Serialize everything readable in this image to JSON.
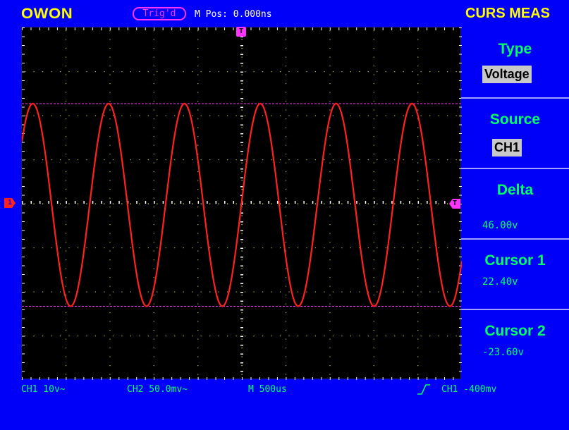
{
  "header": {
    "brand": "OWON",
    "trigger_status": "Trig'd",
    "m_pos": "M Pos: 0.000ns",
    "menu_title": "CURS MEAS"
  },
  "markers": {
    "trigger_pos": "T",
    "ch1_ground": "1",
    "trigger_level": "T"
  },
  "menu": {
    "type_label": "Type",
    "type_value": "Voltage",
    "source_label": "Source",
    "source_value": "CH1",
    "delta_label": "Delta",
    "delta_value": "46.00v",
    "cursor1_label": "Cursor 1",
    "cursor1_value": "22.40v",
    "cursor2_label": "Cursor 2",
    "cursor2_value": "-23.60v"
  },
  "status_bar": {
    "ch1": "CH1 10v~",
    "ch2": "CH2 50.0mv~",
    "timebase": "M 500us",
    "trigger": "CH1 -400mv"
  },
  "colors": {
    "background": "#0000f8",
    "screen": "#000000",
    "waveform": "#ff2020",
    "cursor": "#ff33ff",
    "menu_text": "#00ff66",
    "brand": "#ffff00"
  },
  "waveform": {
    "shape": "sine",
    "cycles": 5.8,
    "cursor1_v": 22.4,
    "cursor2_v": -23.6
  },
  "icons": {
    "trigger_edge": "rising-edge-icon"
  }
}
